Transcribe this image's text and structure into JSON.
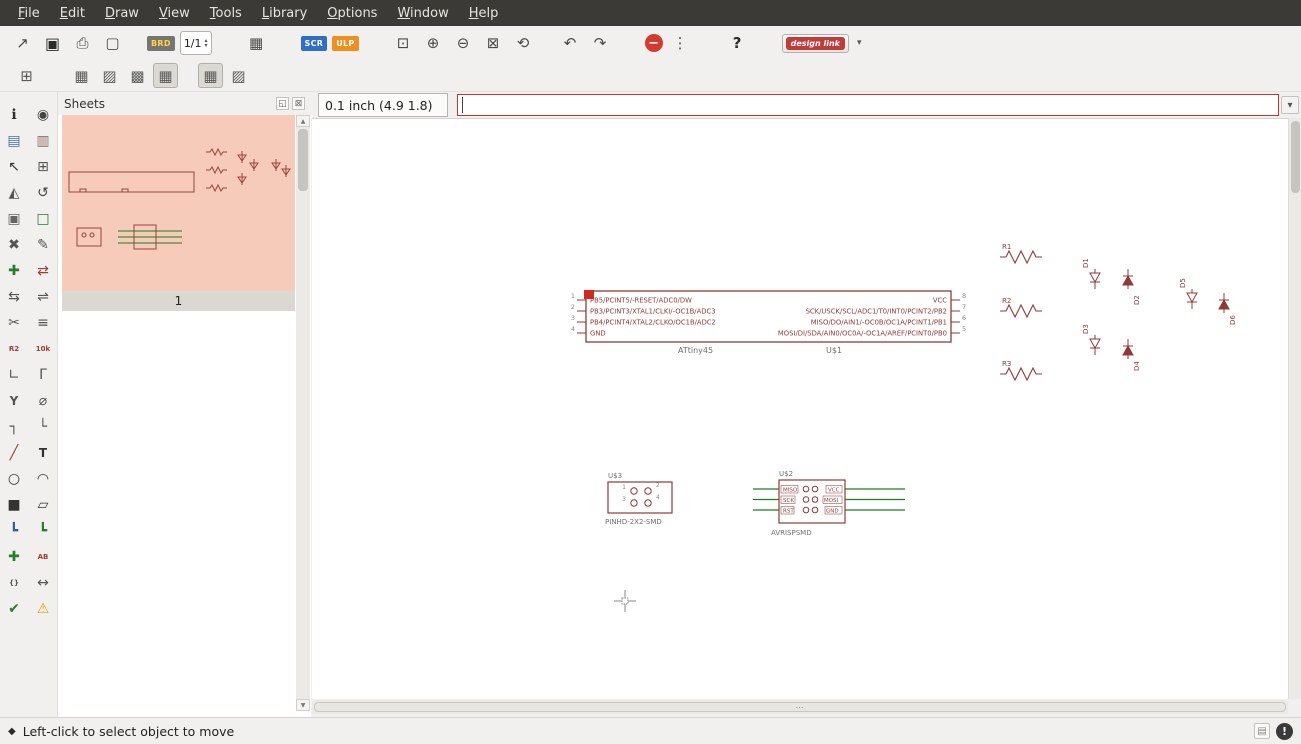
{
  "colors": {
    "accent_red": "#c8372d",
    "thumbnail_salmon": "#f7cbba",
    "symbol_maroon": "#8e3b35",
    "wire_green": "#1e7d1e",
    "scr_blue": "#2f6fc4",
    "ulp_orange": "#ef8f1f",
    "stop_red": "#d23b2f",
    "warning_yellow": "#e0a500",
    "design_link_red": "#c23b3b"
  },
  "menubar": {
    "items": [
      {
        "name": "menu-file",
        "label": "File"
      },
      {
        "name": "menu-edit",
        "label": "Edit"
      },
      {
        "name": "menu-draw",
        "label": "Draw"
      },
      {
        "name": "menu-view",
        "label": "View"
      },
      {
        "name": "menu-tools",
        "label": "Tools"
      },
      {
        "name": "menu-library",
        "label": "Library"
      },
      {
        "name": "menu-options",
        "label": "Options"
      },
      {
        "name": "menu-window",
        "label": "Window"
      },
      {
        "name": "menu-help",
        "label": "Help"
      }
    ]
  },
  "toolbar1": {
    "open_icon": "↗",
    "save_icon": "▣",
    "print_icon": "⎙",
    "cam_icon": "▢",
    "brd_label": "BRD",
    "sheet_indicator": "1/1",
    "spin_up": "▴",
    "spin_down": "▾",
    "grid_icon": "▦",
    "scr_label": "SCR",
    "ulp_label": "ULP",
    "zoom_fit_icon": "⊡",
    "zoom_in_icon": "⊕",
    "zoom_out_icon": "⊖",
    "zoom_select_icon": "⊠",
    "zoom_redraw_icon": "⟲",
    "undo_icon": "↶",
    "redo_icon": "↷",
    "stop_icon": "−",
    "go_icon": "⋮",
    "help_icon": "?",
    "design_link_label": "design link",
    "design_link_caret": "▾"
  },
  "toolbar2": {
    "grid_settings_icon": "⊞",
    "group1": [
      {
        "name": "display-preset-1",
        "glyph": "▦"
      },
      {
        "name": "display-preset-2",
        "glyph": "▨"
      },
      {
        "name": "display-preset-3",
        "glyph": "▩"
      },
      {
        "name": "display-preset-4",
        "glyph": "▦",
        "cls": "pressed"
      }
    ],
    "group2": [
      {
        "name": "display-preset-5",
        "glyph": "▦",
        "cls": "pressed"
      },
      {
        "name": "display-preset-6",
        "glyph": "▨"
      }
    ]
  },
  "left_toolbar": {
    "items": [
      {
        "name": "info-icon",
        "glyph": "ℹ",
        "color": "#2d2d2d"
      },
      {
        "name": "show-icon",
        "glyph": "◉",
        "color": "#444444"
      },
      {
        "name": "display-layers-icon",
        "glyph": "▤",
        "color": "#4472a8"
      },
      {
        "name": "layer-settings-icon",
        "glyph": "▥",
        "color": "#8a6d5c"
      },
      {
        "name": "move-icon",
        "glyph": "↖",
        "color": "#333333"
      },
      {
        "name": "group-icon",
        "glyph": "⊞",
        "color": "#555555"
      },
      {
        "name": "mirror-icon",
        "glyph": "◭",
        "color": "#555555"
      },
      {
        "name": "rotate-icon",
        "glyph": "↺",
        "color": "#444444"
      },
      {
        "name": "copy-icon",
        "glyph": "▣",
        "color": "#666666"
      },
      {
        "name": "paste-icon",
        "glyph": "□",
        "color": "#2a7d2a"
      },
      {
        "name": "delete-icon",
        "glyph": "✖",
        "color": "#555555"
      },
      {
        "name": "change-icon",
        "glyph": "✎",
        "color": "#555555"
      },
      {
        "name": "add-part-icon",
        "glyph": "✚",
        "color": "#2a7d2a"
      },
      {
        "name": "replace-icon",
        "glyph": "⇄",
        "color": "#a33c35"
      },
      {
        "name": "pinswap-icon",
        "glyph": "⇆",
        "color": "#555555"
      },
      {
        "name": "gateswap-icon",
        "glyph": "⇌",
        "color": "#555555"
      },
      {
        "name": "cut-icon",
        "glyph": "✂",
        "color": "#555555"
      },
      {
        "name": "invoke-icon",
        "glyph": "≡",
        "color": "#555555"
      },
      {
        "name": "smash-icon",
        "glyph": "R2",
        "cls": "txt",
        "color": "#a33c35"
      },
      {
        "name": "value-icon",
        "glyph": "10k",
        "cls": "txt",
        "color": "#a33c35"
      },
      {
        "name": "miter-icon",
        "glyph": "∟",
        "color": "#555555"
      },
      {
        "name": "unmiter-icon",
        "glyph": "Γ",
        "color": "#555555"
      },
      {
        "name": "split-icon",
        "glyph": "Y",
        "cls": "txt2",
        "color": "#555555"
      },
      {
        "name": "optimize-icon",
        "glyph": "⌀",
        "color": "#555555"
      },
      {
        "name": "wire-bend-icon",
        "glyph": "┐",
        "color": "#555555"
      },
      {
        "name": "wire-bend-alt-icon",
        "glyph": "└",
        "color": "#555555"
      },
      {
        "name": "wire-icon",
        "glyph": "╱",
        "color": "#a33c35"
      },
      {
        "name": "text-icon",
        "glyph": "T",
        "cls": "txt2",
        "color": "#333333"
      },
      {
        "name": "circle-icon",
        "glyph": "○",
        "color": "#333333"
      },
      {
        "name": "arc-icon",
        "glyph": "◠",
        "color": "#333333"
      },
      {
        "name": "rect-icon",
        "glyph": "■",
        "color": "#333333"
      },
      {
        "name": "polygon-icon",
        "glyph": "▱",
        "color": "#333333"
      },
      {
        "name": "bus-icon",
        "glyph": "┗",
        "color": "#2a5db0"
      },
      {
        "name": "net-icon",
        "glyph": "┗",
        "color": "#2a7d2a"
      },
      {
        "name": "junction-icon",
        "glyph": "✚",
        "color": "#2a7d2a"
      },
      {
        "name": "label-icon",
        "glyph": "AB",
        "cls": "txt",
        "color": "#a33c35"
      },
      {
        "name": "attribute-icon",
        "glyph": "{}",
        "cls": "txt",
        "color": "#555555"
      },
      {
        "name": "dimension-icon",
        "glyph": "↔",
        "color": "#555555"
      },
      {
        "name": "erc-icon",
        "glyph": "✔",
        "color": "#2a7d2a"
      },
      {
        "name": "errors-icon",
        "glyph": "⚠",
        "color": "#e0a500"
      }
    ]
  },
  "sheets_panel": {
    "title": "Sheets",
    "float_icon": "◱",
    "close_icon": "⊠",
    "sheet_number": "1",
    "scroll_up": "▲",
    "scroll_down": "▼"
  },
  "command_bar": {
    "coordinates": "0.1 inch (4.9 1.8)",
    "command_value": "",
    "dropdown_icon": "▾"
  },
  "schematic": {
    "u1": {
      "name": "U$1",
      "value": "ATtiny45",
      "pins_left": [
        {
          "n": "1",
          "l": "PB5/PCINT5/-RESET/ADC0/DW"
        },
        {
          "n": "2",
          "l": "PB3/PCINT3/XTAL1/CLKI/-OC1B/ADC3"
        },
        {
          "n": "3",
          "l": "PB4/PCINT4/XTAL2/CLKO/OC1B/ADC2"
        },
        {
          "n": "4",
          "l": "GND"
        }
      ],
      "pins_right": [
        {
          "n": "8",
          "l": "VCC"
        },
        {
          "n": "7",
          "l": "SCK/USCK/SCL/ADC1/T0/INT0/PCINT2/PB2"
        },
        {
          "n": "6",
          "l": "MISO/DO/AIN1/-OC0B/OC1A/PCINT1/PB1"
        },
        {
          "n": "5",
          "l": "MOSI/DI/SDA/AIN0/OC0A/-OC1A/AREF/PCINT0/PB0"
        }
      ]
    },
    "resistors": [
      {
        "name": "R1"
      },
      {
        "name": "R2"
      },
      {
        "name": "R3"
      }
    ],
    "diodes": [
      {
        "name": "D1"
      },
      {
        "name": "D2"
      },
      {
        "name": "D3"
      },
      {
        "name": "D4"
      },
      {
        "name": "D5"
      },
      {
        "name": "D6"
      }
    ],
    "u3": {
      "name": "U$3",
      "value": "PINHD-2X2-SMD",
      "pins": [
        "1",
        "2",
        "3",
        "4"
      ]
    },
    "u2": {
      "name": "U$2",
      "value": "AVRISPSMD",
      "pins_left": [
        "MISO",
        "SCK",
        "RST"
      ],
      "pins_right": [
        "VCC",
        "MOSI",
        "GND"
      ]
    }
  },
  "statusbar": {
    "bullet": "◆",
    "message": "Left-click to select object to move",
    "dock_icon": "▤",
    "alert_icon": "!"
  }
}
